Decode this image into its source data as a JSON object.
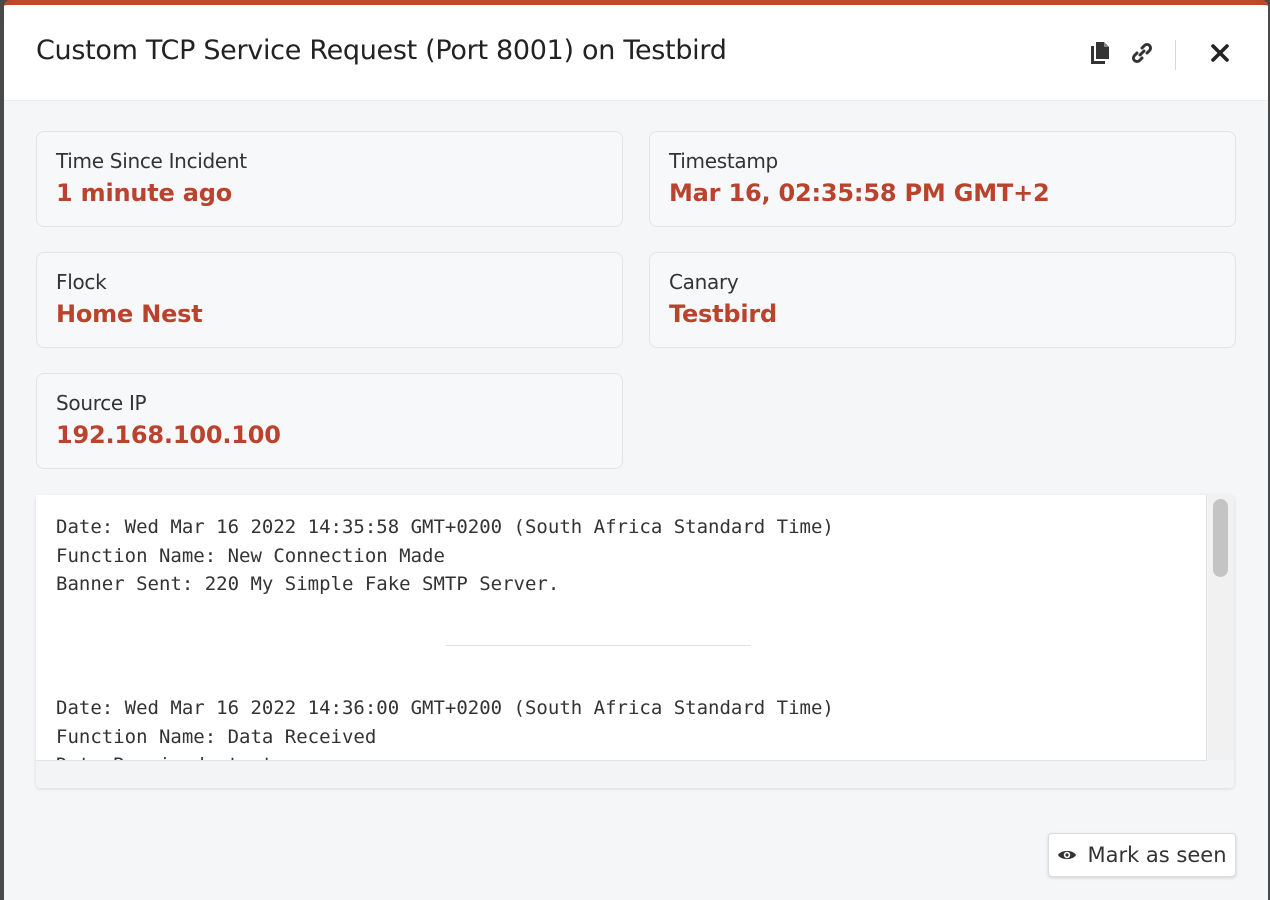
{
  "modal": {
    "title": "Custom TCP Service Request (Port 8001) on Testbird",
    "accent_color": "#c0462f",
    "value_color": "#b9432d",
    "header_icons": [
      "copy-icon",
      "link-icon",
      "close-icon"
    ]
  },
  "cards": {
    "time_since": {
      "label": "Time Since Incident",
      "value": "1 minute ago"
    },
    "timestamp": {
      "label": "Timestamp",
      "value": "Mar 16, 02:35:58 PM GMT+2"
    },
    "flock": {
      "label": "Flock",
      "value": "Home Nest"
    },
    "canary": {
      "label": "Canary",
      "value": "Testbird"
    },
    "source_ip": {
      "label": "Source IP",
      "value": "192.168.100.100"
    }
  },
  "log": {
    "entries": [
      {
        "date": "Date: Wed Mar 16 2022 14:35:58 GMT+0200 (South Africa Standard Time)",
        "function": "Function Name: New Connection Made",
        "detail": "Banner Sent: 220 My Simple Fake SMTP Server."
      },
      {
        "date": "Date: Wed Mar 16 2022 14:36:00 GMT+0200 (South Africa Standard Time)",
        "function": "Function Name: Data Received",
        "detail": "Data Received: test"
      }
    ]
  },
  "footer": {
    "mark_seen_label": "Mark as seen",
    "mark_seen_icon": "eye-icon"
  }
}
